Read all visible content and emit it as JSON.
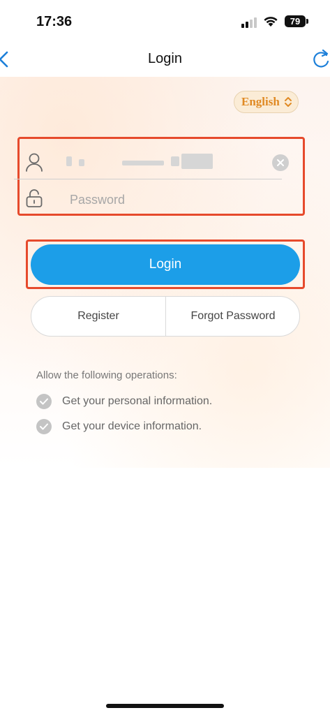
{
  "status_bar": {
    "time": "17:36",
    "battery": "79"
  },
  "nav": {
    "title": "Login",
    "back_icon": "chevron-left-icon",
    "refresh_icon": "refresh-icon"
  },
  "language": {
    "label": "English",
    "icon": "chevron-up-down-icon"
  },
  "form": {
    "username_icon": "user-icon",
    "password_icon": "lock-icon",
    "password_placeholder": "Password",
    "clear_icon": "clear-icon"
  },
  "buttons": {
    "login": "Login",
    "register": "Register",
    "forgot_password": "Forgot Password"
  },
  "permissions": {
    "heading": "Allow the following operations:",
    "items": [
      {
        "label": "Get your personal information.",
        "icon": "check-circle-icon"
      },
      {
        "label": "Get your device information.",
        "icon": "check-circle-icon"
      }
    ]
  },
  "colors": {
    "accent": "#1c9ee8",
    "highlight_border": "#e64a2c",
    "language_text": "#e08a24",
    "nav_icon": "#1c7fd9"
  }
}
